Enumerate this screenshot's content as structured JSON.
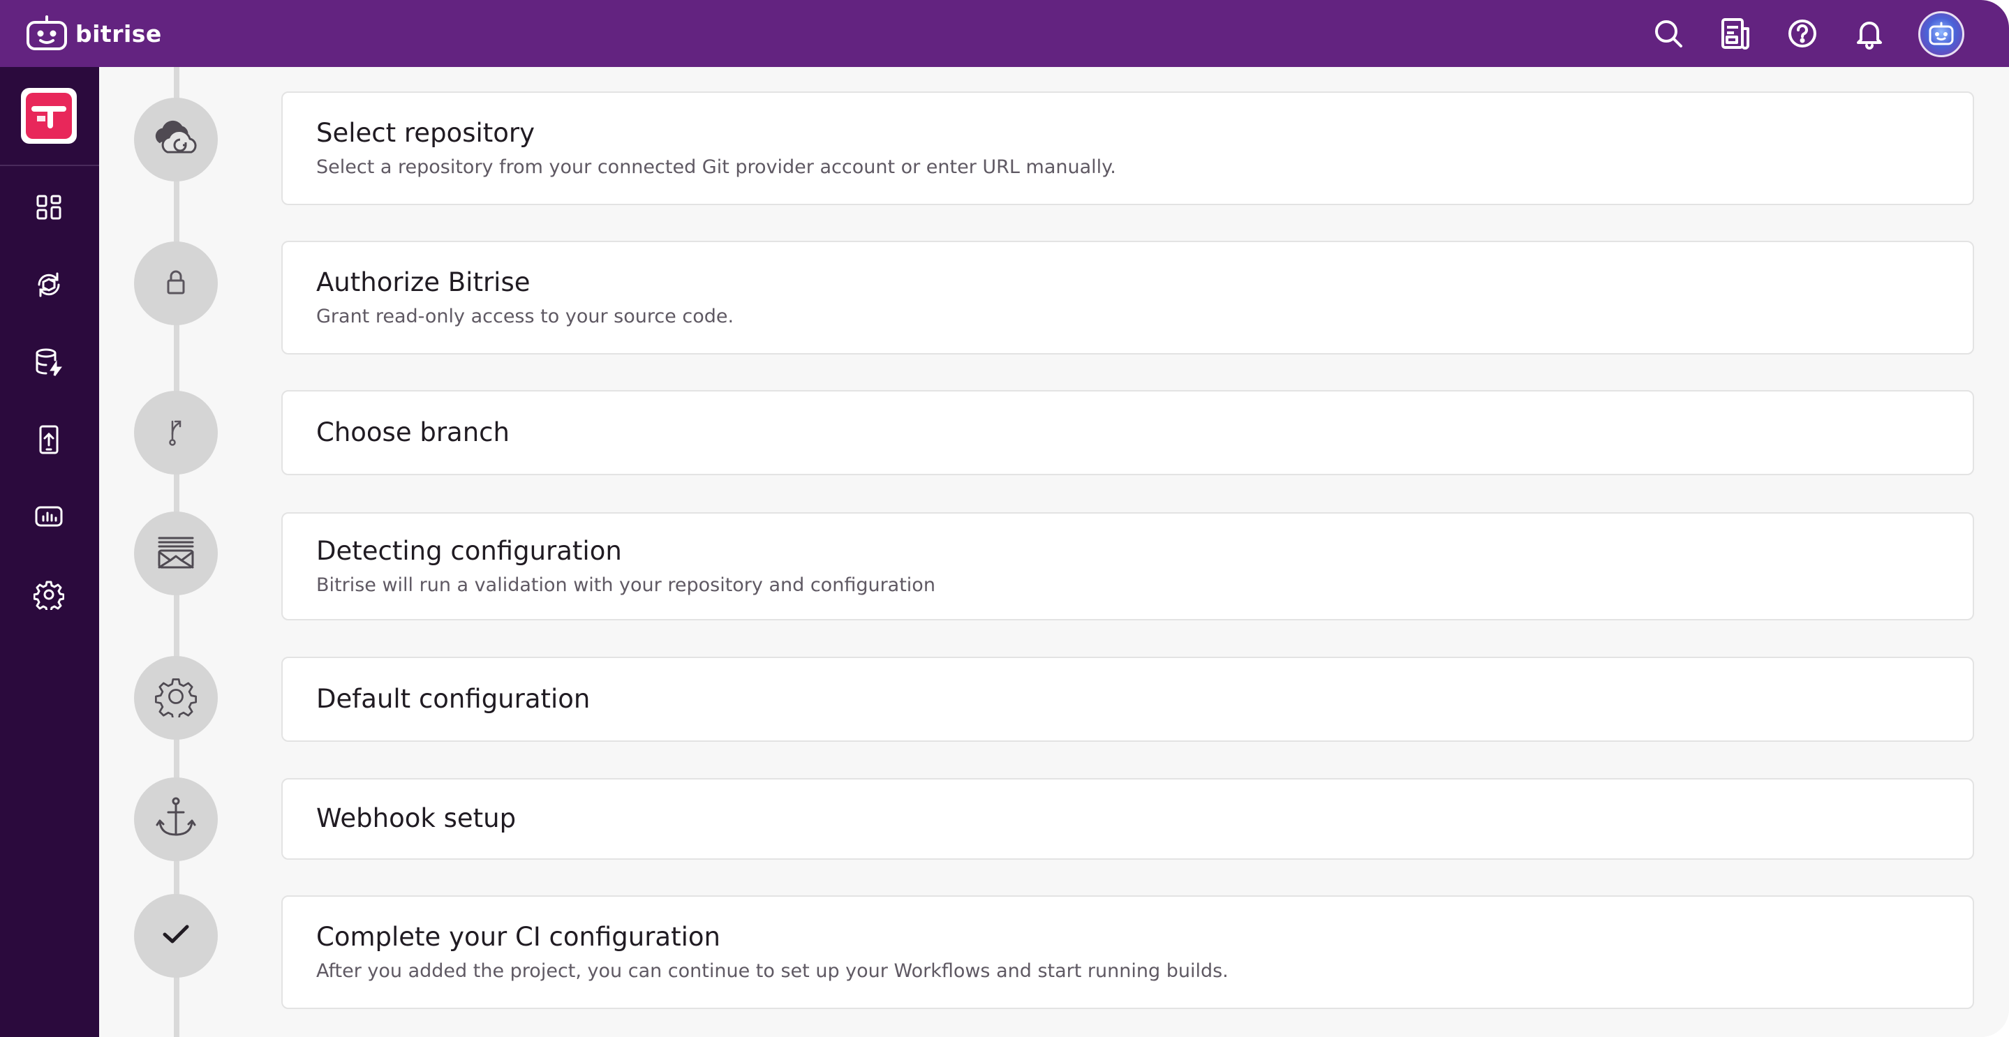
{
  "app": {
    "brand_name": "bitrise",
    "brand_color": "#632380",
    "sidebar_color": "#2b0a3d"
  },
  "topbar": {
    "icons": [
      "search-icon",
      "docs-icon",
      "help-icon",
      "notification-bell-icon",
      "user-avatar"
    ]
  },
  "sidebar": {
    "items": [
      {
        "name": "dashboard-icon"
      },
      {
        "name": "builds-icon"
      },
      {
        "name": "build-cache-icon"
      },
      {
        "name": "release-management-icon"
      },
      {
        "name": "insights-icon"
      },
      {
        "name": "settings-icon"
      }
    ]
  },
  "steps": [
    {
      "title": "Select repository",
      "description": "Select a repository from your connected Git provider account or enter URL manually.",
      "icon": "cloud-icon"
    },
    {
      "title": "Authorize Bitrise",
      "description": "Grant read-only access to your source code.",
      "icon": "lock-icon"
    },
    {
      "title": "Choose branch",
      "description": "",
      "icon": "branch-icon"
    },
    {
      "title": "Detecting configuration",
      "description": "Bitrise will run a validation with your repository and configuration",
      "icon": "config-scan-icon"
    },
    {
      "title": "Default configuration",
      "description": "",
      "icon": "gear-icon"
    },
    {
      "title": "Webhook setup",
      "description": "",
      "icon": "anchor-icon"
    },
    {
      "title": "Complete your CI configuration",
      "description": "After you added the project, you can continue to set up your Workflows and start running builds.",
      "icon": "checkmark-icon"
    }
  ]
}
